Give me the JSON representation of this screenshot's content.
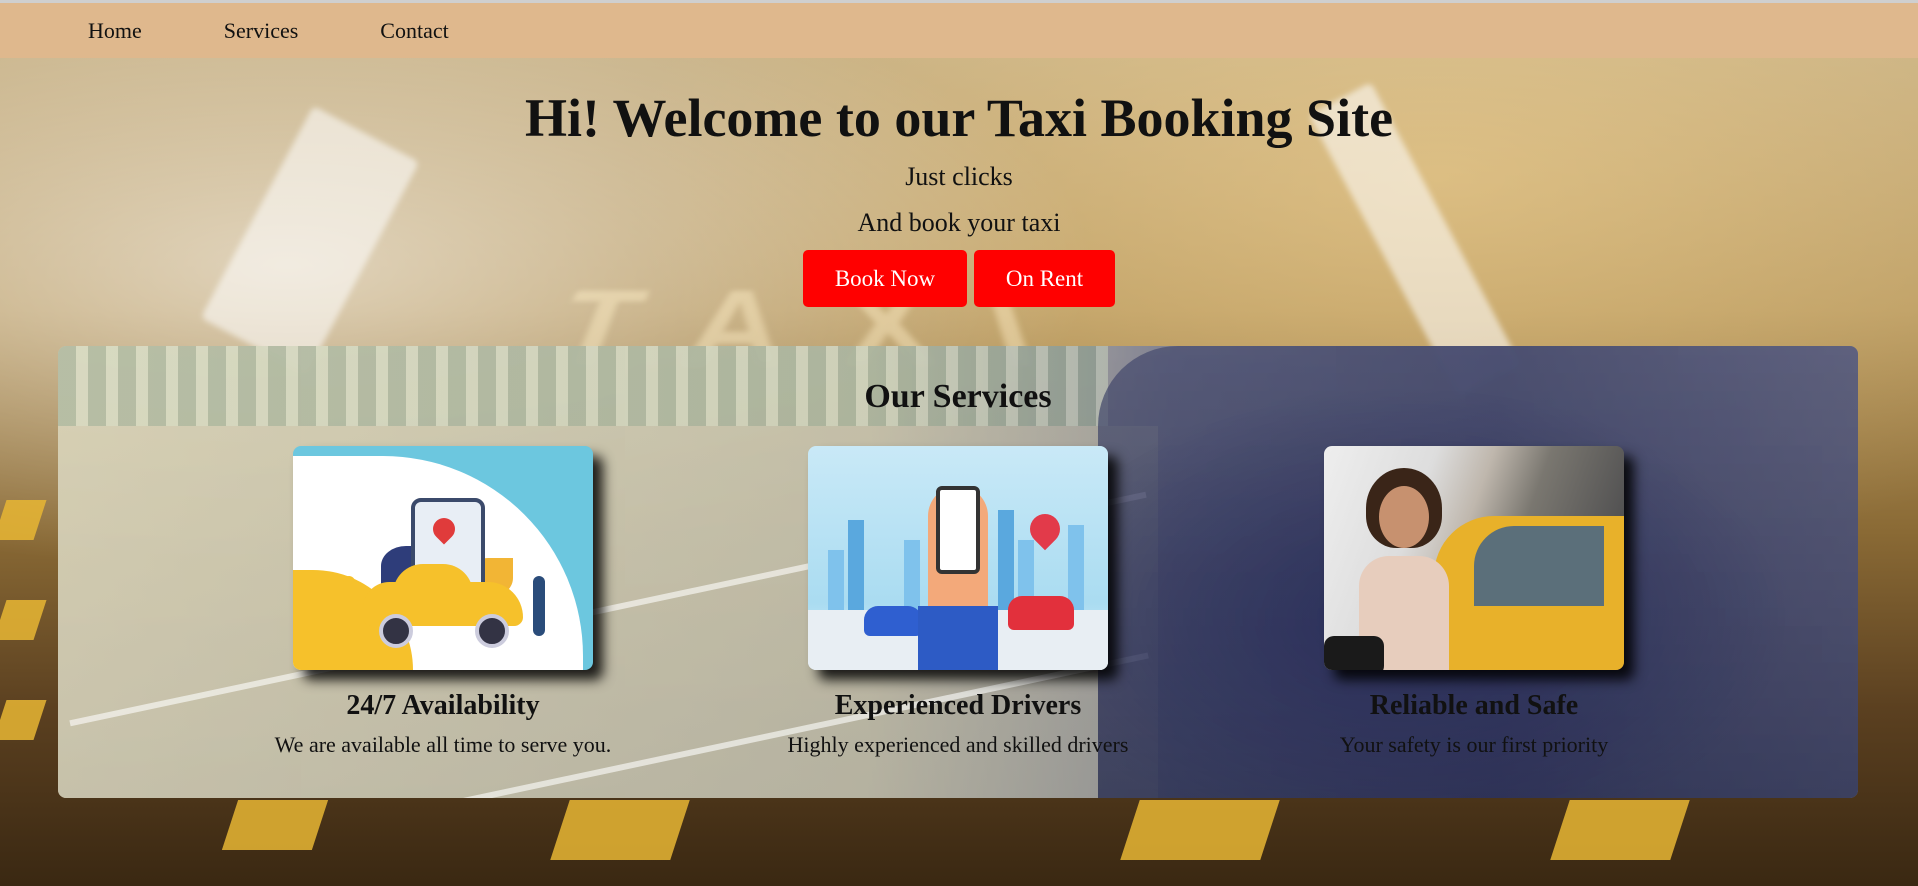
{
  "nav": {
    "items": [
      {
        "label": "Home"
      },
      {
        "label": "Services"
      },
      {
        "label": "Contact"
      }
    ]
  },
  "hero": {
    "title": "Hi! Welcome to our Taxi Booking Site",
    "subtitle_1": "Just clicks",
    "subtitle_2": "And book your taxi",
    "buttons": {
      "book_now": "Book Now",
      "on_rent": "On Rent"
    }
  },
  "services": {
    "title": "Our Services",
    "cards": [
      {
        "title": "24/7 Availability",
        "description": "We are available all time to serve you.",
        "image": "taxi-app-illustration"
      },
      {
        "title": "Experienced Drivers",
        "description": "Highly experienced and skilled drivers",
        "image": "phone-map-illustration"
      },
      {
        "title": "Reliable and Safe",
        "description": "Your safety is our first priority",
        "image": "woman-entering-taxi-photo"
      }
    ]
  },
  "colors": {
    "nav_bg": "#dfb88d",
    "button_bg": "#ff0000",
    "button_text": "#ffffff"
  }
}
